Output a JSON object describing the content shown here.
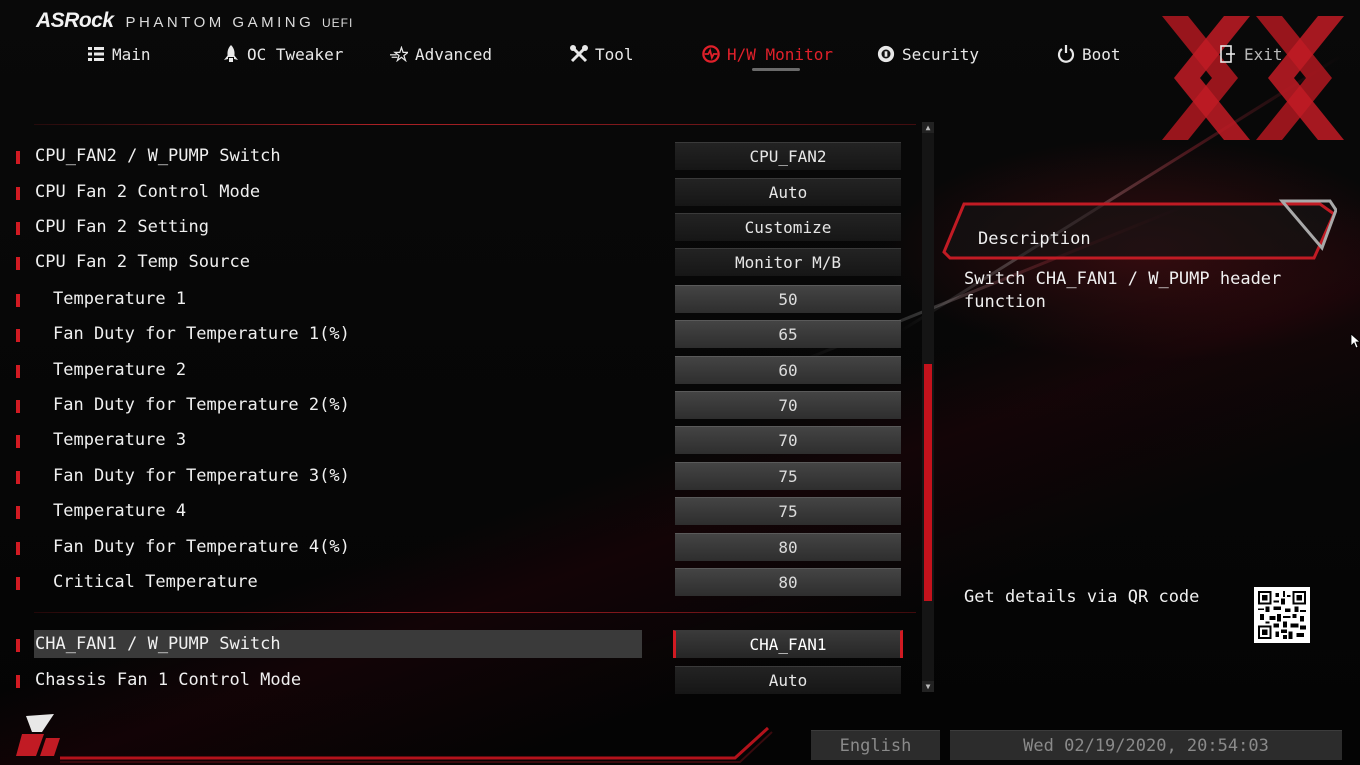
{
  "brand": {
    "name": "ASRock",
    "subtitle": "PHANTOM GAMING",
    "subtitle_suffix": "UEFI"
  },
  "nav": {
    "items": [
      {
        "label": "Main",
        "icon": "list-icon",
        "active": false
      },
      {
        "label": "OC Tweaker",
        "icon": "rocket-icon",
        "active": false
      },
      {
        "label": "Advanced",
        "icon": "star-icon",
        "active": false
      },
      {
        "label": "Tool",
        "icon": "tools-icon",
        "active": false
      },
      {
        "label": "H/W Monitor",
        "icon": "monitor-icon",
        "active": true
      },
      {
        "label": "Security",
        "icon": "shield-icon",
        "active": false
      },
      {
        "label": "Boot",
        "icon": "power-icon",
        "active": false
      },
      {
        "label": "Exit",
        "icon": "exit-icon",
        "active": false
      }
    ]
  },
  "settings": [
    {
      "label": "CPU_FAN2 / W_PUMP Switch",
      "value": "CPU_FAN2",
      "indent": false,
      "numeric": false
    },
    {
      "label": "CPU Fan 2 Control Mode",
      "value": "Auto",
      "indent": false,
      "numeric": false
    },
    {
      "label": "CPU Fan 2 Setting",
      "value": "Customize",
      "indent": false,
      "numeric": false
    },
    {
      "label": "CPU Fan 2 Temp Source",
      "value": "Monitor M/B",
      "indent": false,
      "numeric": false
    },
    {
      "label": "Temperature 1",
      "value": "50",
      "indent": true,
      "numeric": true
    },
    {
      "label": "Fan Duty for Temperature 1(%)",
      "value": "65",
      "indent": true,
      "numeric": true
    },
    {
      "label": "Temperature 2",
      "value": "60",
      "indent": true,
      "numeric": true
    },
    {
      "label": "Fan Duty for Temperature 2(%)",
      "value": "70",
      "indent": true,
      "numeric": true
    },
    {
      "label": "Temperature 3",
      "value": "70",
      "indent": true,
      "numeric": true
    },
    {
      "label": "Fan Duty for Temperature 3(%)",
      "value": "75",
      "indent": true,
      "numeric": true
    },
    {
      "label": "Temperature 4",
      "value": "75",
      "indent": true,
      "numeric": true
    },
    {
      "label": "Fan Duty for Temperature 4(%)",
      "value": "80",
      "indent": true,
      "numeric": true
    },
    {
      "label": "Critical Temperature",
      "value": "80",
      "indent": true,
      "numeric": true
    },
    {
      "label": "CHA_FAN1 / W_PUMP Switch",
      "value": "CHA_FAN1",
      "indent": false,
      "numeric": false,
      "selected": true
    },
    {
      "label": "Chassis Fan 1 Control Mode",
      "value": "Auto",
      "indent": false,
      "numeric": false
    }
  ],
  "description": {
    "title": "Description",
    "text": "Switch CHA_FAN1 / W_PUMP header function",
    "qr_label": "Get details via QR code"
  },
  "footer": {
    "language": "English",
    "datetime": "Wed 02/19/2020, 20:54:03"
  },
  "colors": {
    "accent": "#d11a22",
    "active_tab": "#e0202a",
    "background": "#050505"
  }
}
